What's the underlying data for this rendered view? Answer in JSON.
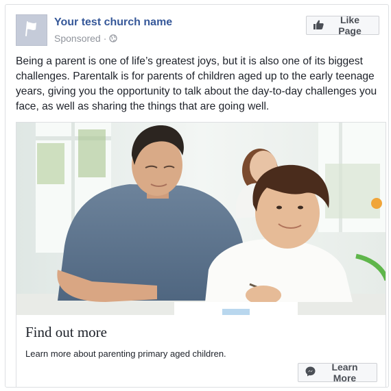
{
  "post": {
    "page_name": "Your test church name",
    "sponsored_label": "Sponsored",
    "separator": "·",
    "privacy_icon": "globe-icon",
    "avatar_icon": "flag-icon",
    "like_page_label": "Like Page",
    "like_icon": "thumbs-up-icon",
    "body_text": "Being a parent is one of life’s greatest joys, but it is also one of its biggest challenges. Parentalk is for parents of children aged up to the early teenage years, giving you the opportunity to talk about the day-to-day challenges you face, as well as sharing the things that are going well."
  },
  "image": {
    "subject": "father-helping-son-with-homework-photo"
  },
  "cta": {
    "title": "Find out more",
    "description": "Learn more about parenting primary aged children.",
    "button_label": "Learn More",
    "button_icon": "messenger-icon"
  },
  "colors": {
    "link_blue": "#365899",
    "muted_text": "#90949c",
    "border": "#dddfe2",
    "button_bg": "#f6f7f9"
  }
}
